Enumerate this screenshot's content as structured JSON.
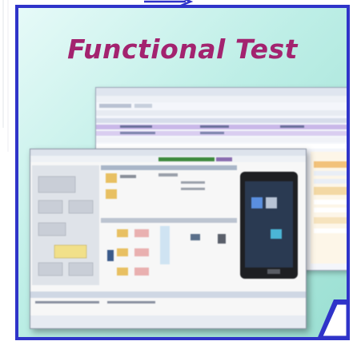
{
  "slide": {
    "title": "Functional Test"
  },
  "colors": {
    "border": "#2f34c9",
    "title": "#a3236f",
    "background_start": "#e6faf8",
    "background_end": "#9adfd2"
  },
  "icons": [
    "arrow-icon",
    "page-fold-icon",
    "phone-device-icon"
  ]
}
